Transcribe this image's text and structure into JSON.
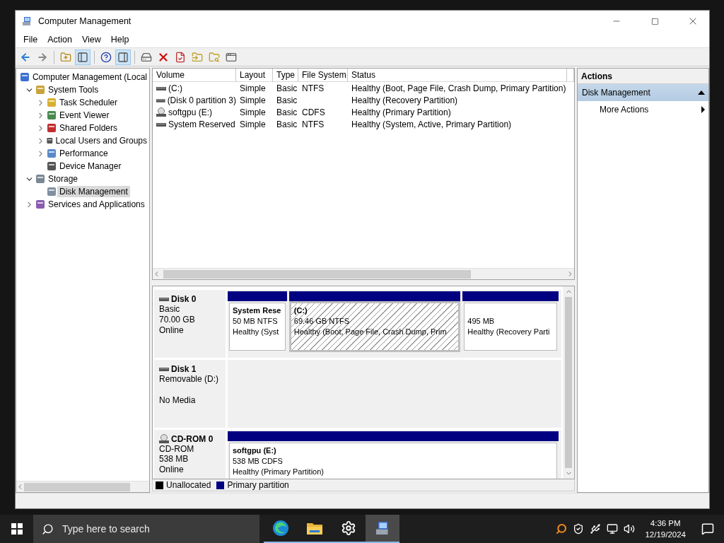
{
  "window": {
    "title": "Computer Management"
  },
  "menu": [
    "File",
    "Action",
    "View",
    "Help"
  ],
  "toolbar_toggles": {
    "console_tree": true,
    "action_pane": true
  },
  "tree": [
    {
      "label": "Computer Management (Local",
      "selected": false,
      "children": [
        {
          "label": "System Tools",
          "expanded": true,
          "selected": false,
          "children": [
            {
              "label": "Task Scheduler",
              "expanded": false,
              "selected": false
            },
            {
              "label": "Event Viewer",
              "expanded": false,
              "selected": false
            },
            {
              "label": "Shared Folders",
              "expanded": false,
              "selected": false
            },
            {
              "label": "Local Users and Groups",
              "expanded": false,
              "selected": false
            },
            {
              "label": "Performance",
              "expanded": false,
              "selected": false
            },
            {
              "label": "Device Manager",
              "selected": false
            }
          ]
        },
        {
          "label": "Storage",
          "expanded": true,
          "selected": false,
          "children": [
            {
              "label": "Disk Management",
              "selected": true
            }
          ]
        },
        {
          "label": "Services and Applications",
          "expanded": false,
          "selected": false
        }
      ]
    }
  ],
  "volumes": {
    "columns": [
      "Volume",
      "Layout",
      "Type",
      "File System",
      "Status"
    ],
    "rows": [
      {
        "kind": "disk",
        "cells": [
          "(C:)",
          "Simple",
          "Basic",
          "NTFS",
          "Healthy (Boot, Page File, Crash Dump, Primary Partition)"
        ]
      },
      {
        "kind": "disk",
        "cells": [
          "(Disk 0 partition 3)",
          "Simple",
          "Basic",
          "",
          "Healthy (Recovery Partition)"
        ]
      },
      {
        "kind": "cdrom",
        "cells": [
          "softgpu (E:)",
          "Simple",
          "Basic",
          "CDFS",
          "Healthy (Primary Partition)"
        ]
      },
      {
        "kind": "disk",
        "cells": [
          "System Reserved",
          "Simple",
          "Basic",
          "NTFS",
          "Healthy (System, Active, Primary Partition)"
        ]
      }
    ]
  },
  "disks": [
    {
      "kind": "disk",
      "name": "Disk 0",
      "lines": [
        "Basic",
        "70.00 GB",
        "Online"
      ],
      "partitions": [
        {
          "title": "System Rese",
          "lines": [
            "50 MB NTFS",
            "Healthy (Syst"
          ],
          "selected": false
        },
        {
          "title": "(C:)",
          "lines": [
            "69.46 GB NTFS",
            "Healthy (Boot, Page File, Crash Dump, Prim"
          ],
          "selected": true
        },
        {
          "lines": [
            "495 MB",
            "Healthy (Recovery Parti"
          ],
          "selected": false
        }
      ]
    },
    {
      "kind": "disk",
      "name": "Disk 1",
      "lines": [
        "Removable (D:)",
        "No Media"
      ]
    },
    {
      "kind": "cdrom",
      "name": "CD-ROM 0",
      "lines": [
        "CD-ROM",
        "538 MB",
        "Online"
      ],
      "partitions": [
        {
          "title": "softgpu  (E:)",
          "lines": [
            "538 MB CDFS",
            "Healthy (Primary Partition)"
          ],
          "selected": false
        }
      ]
    }
  ],
  "legend": [
    {
      "label": "Unallocated",
      "color": "#000000"
    },
    {
      "label": "Primary partition",
      "color": "#000080"
    }
  ],
  "actions": {
    "header": "Actions",
    "sections": [
      {
        "title": "Disk Management",
        "expanded": true,
        "items": [
          {
            "label": "More Actions",
            "submenu": true
          }
        ]
      }
    ]
  },
  "taskbar": {
    "search_placeholder": "Type here to search",
    "apps": [
      {
        "kind": "browser",
        "active": false
      },
      {
        "kind": "folder",
        "active": false
      },
      {
        "kind": "settings",
        "active": false
      },
      {
        "kind": "management",
        "active": true
      }
    ],
    "time": "4:36 PM",
    "date": "12/19/2024"
  }
}
